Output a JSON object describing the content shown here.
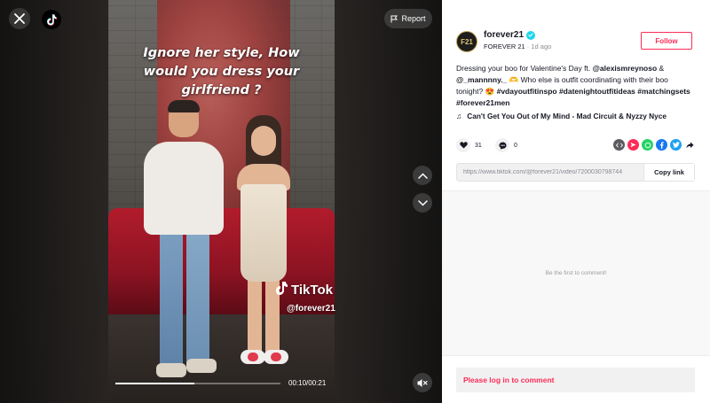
{
  "video": {
    "caption_overlay": "Ignore her style, How would you dress your girlfriend ?",
    "watermark_brand": "TikTok",
    "watermark_handle": "@forever21",
    "time_display": "00:10/00:21",
    "progress": 0.48,
    "report_label": "Report"
  },
  "author": {
    "avatar_text": "F21",
    "username": "forever21",
    "display_name": "FOREVER 21",
    "posted": "1d ago",
    "follow_label": "Follow",
    "verified": true
  },
  "post": {
    "desc_text": "Dressing your boo for Valentine's Day ft. ",
    "mention_1": "@alexismreynoso",
    "amp": " & ",
    "mention_2": "@_mannnny._",
    "emoji_1": " 🫶",
    "desc_text_2": "Who else is outfit coordinating with their boo tonight? ",
    "emoji_2": "😍",
    "hashtags": "#vdayoutfitinspo #datenightoutfitideas #matchingsets #forever21men",
    "music_note": "♫",
    "music_title": "Can't Get You Out of My Mind - Mad Circuit & Nyzzy Nyce"
  },
  "actions": {
    "likes": "31",
    "comments": "0"
  },
  "link": {
    "url": "https://www.tiktok.com/@forever21/video/7200030798744",
    "copy_label": "Copy link"
  },
  "comments": {
    "empty_text": "Be the first to comment!",
    "login_prompt": "Please log in to comment"
  },
  "colors": {
    "brand": "#fe2c55",
    "verified": "#20d5ec",
    "text": "#161823"
  }
}
